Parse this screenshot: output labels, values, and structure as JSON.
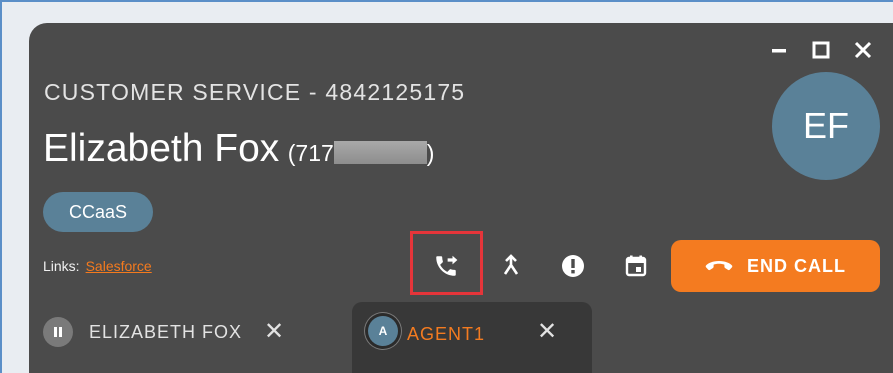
{
  "header": {
    "queue_label": "CUSTOMER SERVICE - 4842125175",
    "caller_name": "Elizabeth Fox",
    "phone_open": "(717",
    "phone_close": ")"
  },
  "window_controls": {
    "minimize": "minimize-icon",
    "maximize": "maximize-icon",
    "close": "close-icon"
  },
  "avatar": {
    "initials": "EF",
    "color": "#5a8198"
  },
  "tags": [
    {
      "label": "CCaaS"
    }
  ],
  "links": {
    "label": "Links:",
    "items": [
      {
        "text": "Salesforce"
      }
    ]
  },
  "toolbar": {
    "icons": [
      "transfer-call-icon",
      "merge-icon",
      "alert-icon",
      "calendar-icon"
    ],
    "end_call_label": "END CALL",
    "accent": "#f47b20",
    "highlight_color": "#e5353a"
  },
  "tabs": [
    {
      "label": "ELIZABETH FOX",
      "icon": "pause-icon",
      "active": false
    },
    {
      "label": "AGENT1",
      "avatar_letter": "A",
      "active": true
    }
  ]
}
